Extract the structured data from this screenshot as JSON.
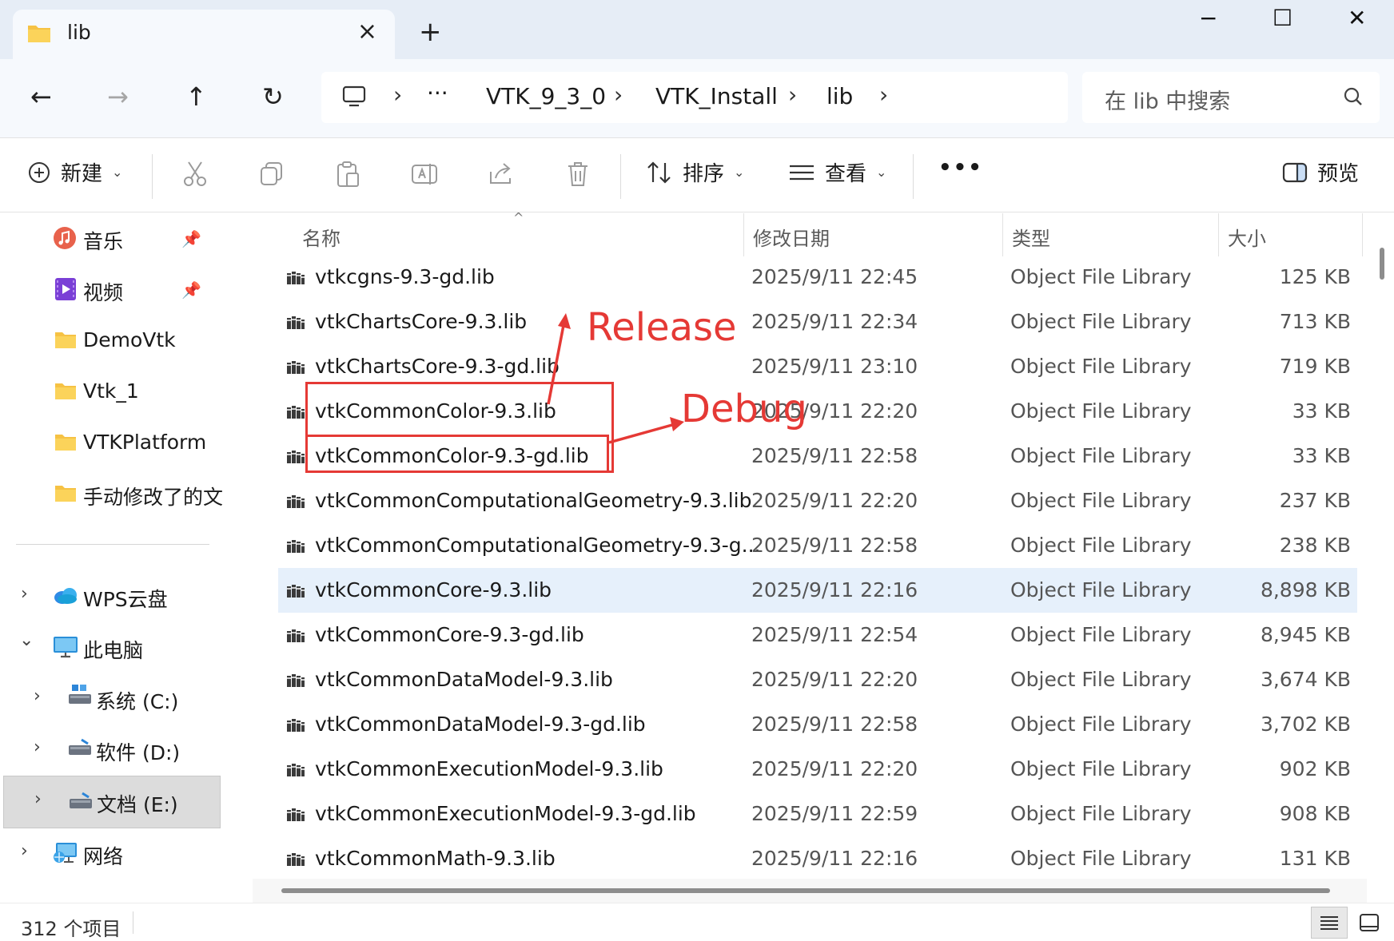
{
  "tab": {
    "title": "lib",
    "close": "×",
    "new_tab": "+"
  },
  "window": {
    "minimize": "−",
    "maximize": "☐",
    "close": "✕"
  },
  "nav": {
    "back": "←",
    "forward": "→",
    "up": "↑",
    "refresh": "↻",
    "breadcrumb_more": "···",
    "breadcrumbs": [
      "VTK_9_3_0",
      "VTK_Install",
      "lib"
    ],
    "separator": "›"
  },
  "search": {
    "placeholder": "在 lib 中搜索"
  },
  "toolbar": {
    "new_label": "新建",
    "sort_label": "排序",
    "view_label": "查看",
    "more_label": "•••",
    "preview_label": "预览"
  },
  "sidebar": {
    "items": [
      {
        "label": "音乐",
        "icon": "music-icon",
        "pinned": true
      },
      {
        "label": "视频",
        "icon": "video-icon",
        "pinned": true
      },
      {
        "label": "DemoVtk",
        "icon": "folder-icon"
      },
      {
        "label": "Vtk_1",
        "icon": "folder-icon"
      },
      {
        "label": "VTKPlatform",
        "icon": "folder-icon"
      },
      {
        "label": "手动修改了的文件",
        "icon": "folder-icon"
      }
    ],
    "tree": [
      {
        "label": "WPS云盘",
        "icon": "cloud-icon",
        "expand": "›"
      },
      {
        "label": "此电脑",
        "icon": "computer-icon",
        "expand": "⌄"
      },
      {
        "label": "系统 (C:)",
        "icon": "drive-icon",
        "expand": "›"
      },
      {
        "label": "软件 (D:)",
        "icon": "drive-icon",
        "expand": "›"
      },
      {
        "label": "文档 (E:)",
        "icon": "drive-icon",
        "expand": "›",
        "selected": true
      },
      {
        "label": "网络",
        "icon": "network-icon",
        "expand": "›"
      }
    ]
  },
  "columns": {
    "name": "名称",
    "date": "修改日期",
    "type": "类型",
    "size": "大小"
  },
  "files": [
    {
      "name": "vtkcgns-9.3-gd.lib",
      "date": "2025/9/11 22:45",
      "type": "Object File Library",
      "size": "125 KB"
    },
    {
      "name": "vtkChartsCore-9.3.lib",
      "date": "2025/9/11 22:34",
      "type": "Object File Library",
      "size": "713 KB"
    },
    {
      "name": "vtkChartsCore-9.3-gd.lib",
      "date": "2025/9/11 23:10",
      "type": "Object File Library",
      "size": "719 KB"
    },
    {
      "name": "vtkCommonColor-9.3.lib",
      "date": "2025/9/11 22:20",
      "type": "Object File Library",
      "size": "33 KB"
    },
    {
      "name": "vtkCommonColor-9.3-gd.lib",
      "date": "2025/9/11 22:58",
      "type": "Object File Library",
      "size": "33 KB"
    },
    {
      "name": "vtkCommonComputationalGeometry-9.3.lib",
      "date": "2025/9/11 22:20",
      "type": "Object File Library",
      "size": "237 KB"
    },
    {
      "name": "vtkCommonComputationalGeometry-9.3-g...",
      "date": "2025/9/11 22:58",
      "type": "Object File Library",
      "size": "238 KB"
    },
    {
      "name": "vtkCommonCore-9.3.lib",
      "date": "2025/9/11 22:16",
      "type": "Object File Library",
      "size": "8,898 KB",
      "selected": true
    },
    {
      "name": "vtkCommonCore-9.3-gd.lib",
      "date": "2025/9/11 22:54",
      "type": "Object File Library",
      "size": "8,945 KB"
    },
    {
      "name": "vtkCommonDataModel-9.3.lib",
      "date": "2025/9/11 22:20",
      "type": "Object File Library",
      "size": "3,674 KB"
    },
    {
      "name": "vtkCommonDataModel-9.3-gd.lib",
      "date": "2025/9/11 22:58",
      "type": "Object File Library",
      "size": "3,702 KB"
    },
    {
      "name": "vtkCommonExecutionModel-9.3.lib",
      "date": "2025/9/11 22:20",
      "type": "Object File Library",
      "size": "902 KB"
    },
    {
      "name": "vtkCommonExecutionModel-9.3-gd.lib",
      "date": "2025/9/11 22:59",
      "type": "Object File Library",
      "size": "908 KB"
    },
    {
      "name": "vtkCommonMath-9.3.lib",
      "date": "2025/9/11 22:16",
      "type": "Object File Library",
      "size": "131 KB"
    }
  ],
  "annotations": {
    "release": "Release",
    "debug": "Debug",
    "color": "#e53935"
  },
  "status": {
    "item_count": "312 个项目"
  }
}
